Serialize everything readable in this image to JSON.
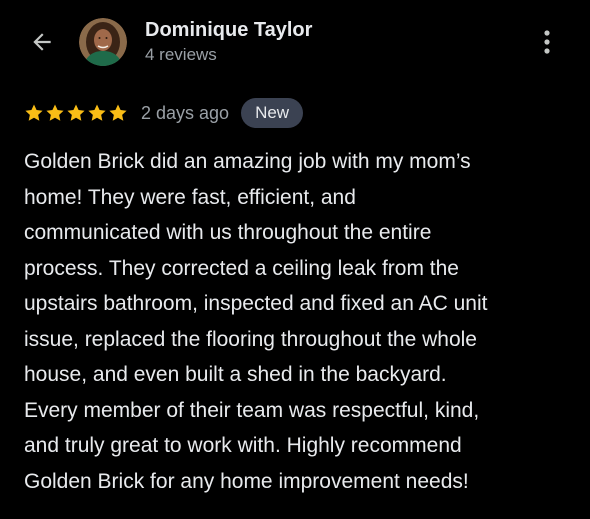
{
  "reviewer": {
    "name": "Dominique Taylor",
    "review_count": "4 reviews"
  },
  "review": {
    "rating": 5,
    "max_rating": 5,
    "date": "2 days ago",
    "badge": "New",
    "lines": [
      "Golden Brick did an amazing job with my mom’s",
      "home! They were fast, efficient, and",
      "communicated with us throughout the entire",
      "process. They corrected a ceiling leak from the",
      "upstairs bathroom, inspected and fixed an AC unit",
      "issue, replaced the flooring throughout the whole",
      "house, and even built a shed in the backyard.",
      "Every member of their team was respectful, kind,",
      "and truly great to work with. Highly recommend",
      "Golden Brick for any home improvement needs!"
    ]
  },
  "icons": {
    "back": "arrow-back-icon",
    "more": "more-vert-icon",
    "star": "star-icon"
  },
  "colors": {
    "background": "#000000",
    "star": "#f9bd16",
    "badge_bg": "#3b4252",
    "text_primary": "#e8eaed",
    "text_secondary": "#9aa0a6"
  }
}
